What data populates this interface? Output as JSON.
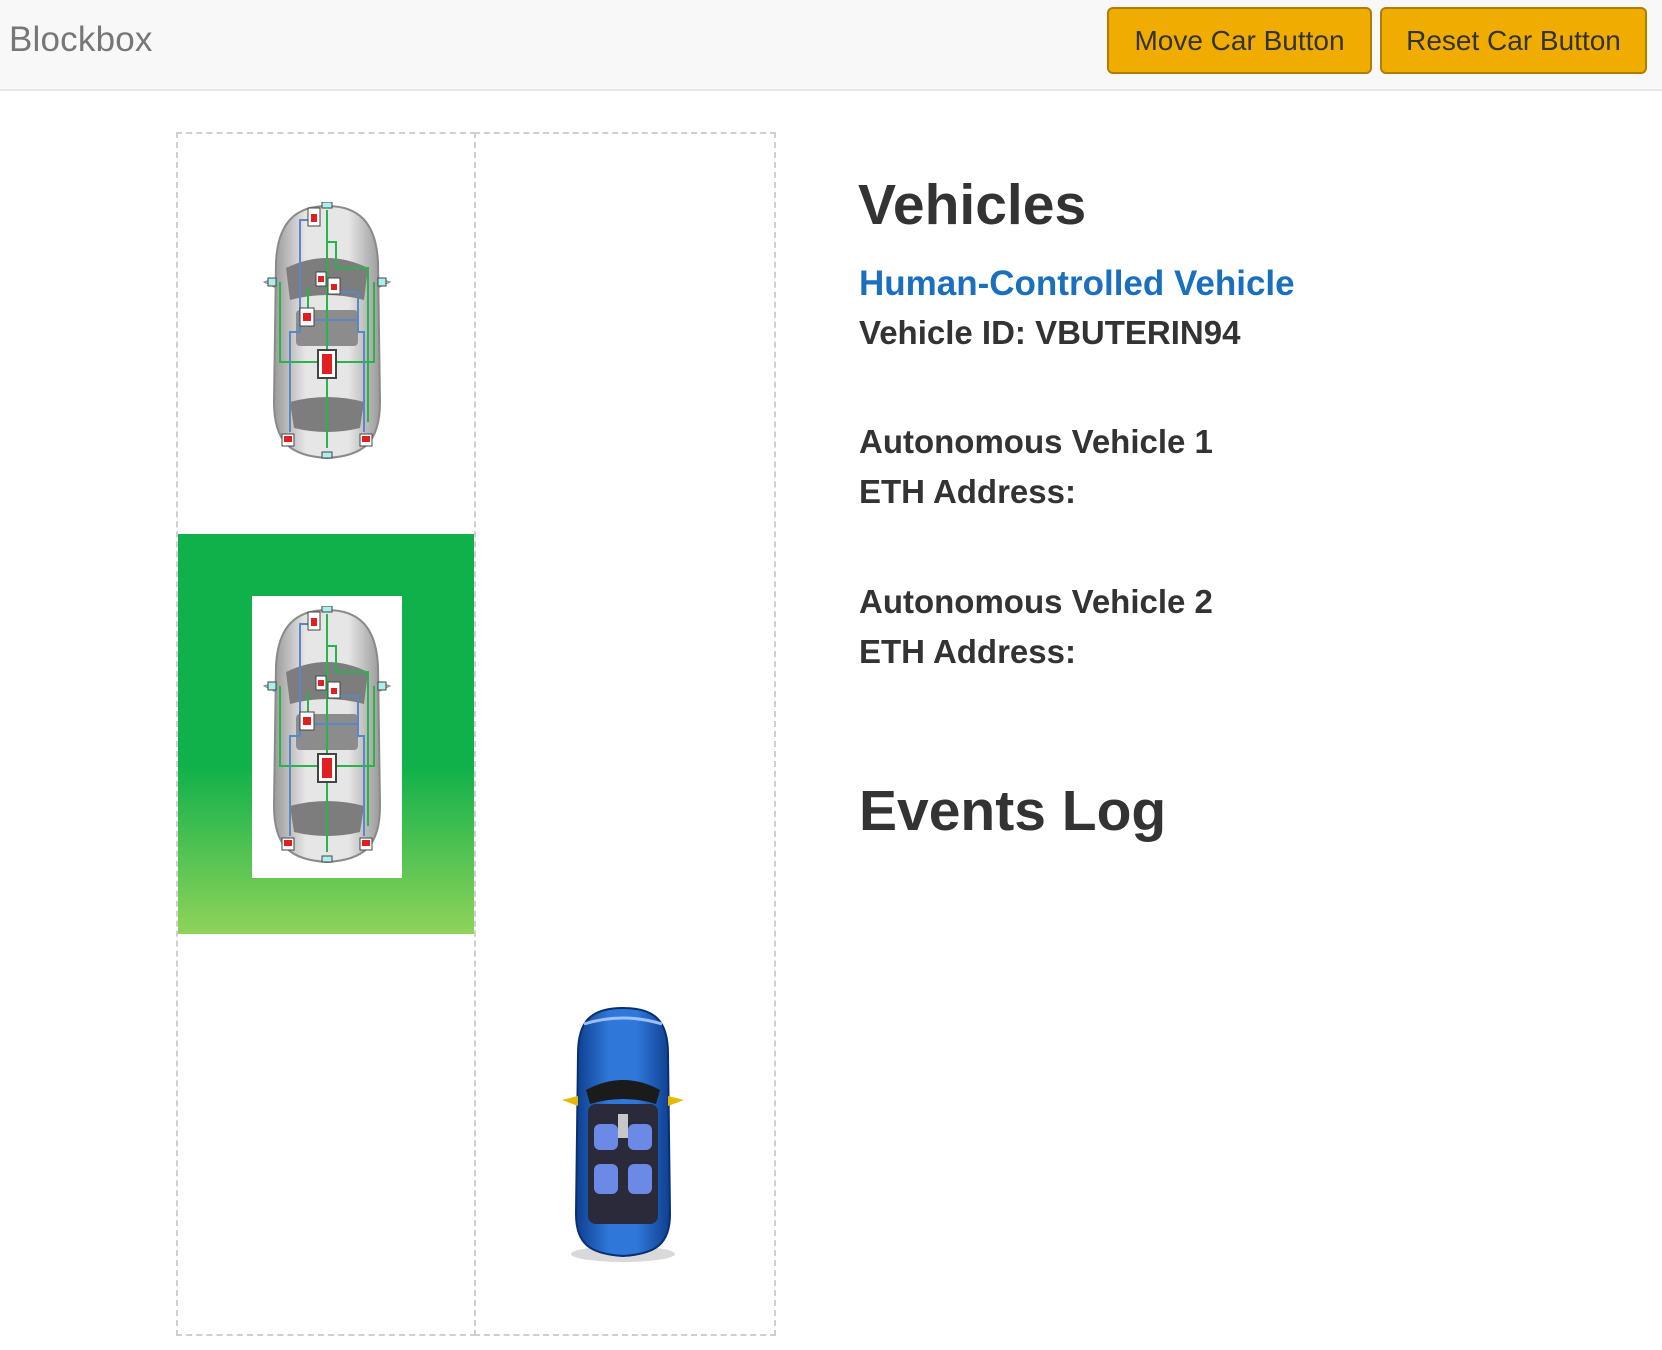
{
  "navbar": {
    "brand": "Blockbox",
    "move_button": "Move Car Button",
    "reset_button": "Reset Car Button",
    "button_color": "#f0ad00"
  },
  "grid": {
    "active_cell_color": "#10b14a",
    "cars": [
      {
        "name": "autonomous-car-icon",
        "lane": "left",
        "row": 1
      },
      {
        "name": "autonomous-car-icon",
        "lane": "left",
        "row": 2,
        "highlighted": true
      },
      {
        "name": "human-car-icon",
        "lane": "right",
        "row": 3,
        "color": "#1f5fbf"
      }
    ]
  },
  "vehicles": {
    "heading": "Vehicles",
    "human": {
      "title": "Human-Controlled Vehicle",
      "id_line": "Vehicle ID: VBUTERIN94",
      "title_color": "#1a6fbf"
    },
    "av1": {
      "title": "Autonomous Vehicle 1",
      "eth_line": "ETH Address:"
    },
    "av2": {
      "title": "Autonomous Vehicle 2",
      "eth_line": "ETH Address:"
    }
  },
  "events": {
    "heading": "Events Log"
  }
}
